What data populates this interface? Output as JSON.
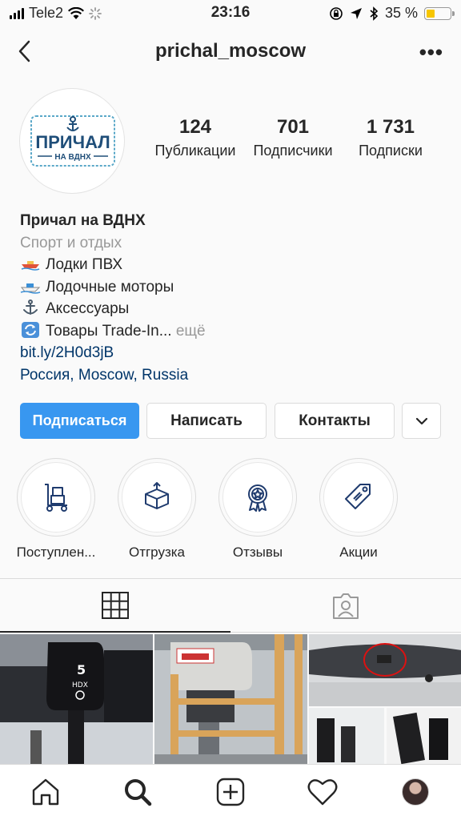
{
  "status": {
    "carrier": "Tele2",
    "time": "23:16",
    "battery": "35 %",
    "battery_level": 0.35
  },
  "header": {
    "username": "prichal_moscow",
    "more": "•••"
  },
  "profile": {
    "avatar_logo_text": "ПРИЧАЛ",
    "avatar_logo_sub": "НА ВДНХ",
    "stats": [
      {
        "num": "124",
        "label": "Публикации"
      },
      {
        "num": "701",
        "label": "Подписчики"
      },
      {
        "num": "1 731",
        "label": "Подписки"
      }
    ]
  },
  "bio": {
    "name": "Причал на ВДНХ",
    "category": "Спорт и отдых",
    "lines": [
      {
        "emoji": "boat-emoji",
        "text": "Лодки ПВХ"
      },
      {
        "emoji": "motorboat-emoji",
        "text": "Лодочные моторы"
      },
      {
        "emoji": "anchor-emoji",
        "text": "Аксессуары"
      },
      {
        "emoji": "repeat-emoji",
        "text": "Товары Trade-In..."
      }
    ],
    "more": "ещё",
    "link": "bit.ly/2H0d3jB",
    "location": "Россия, Moscow, Russia"
  },
  "buttons": {
    "follow": "Подписаться",
    "message": "Написать",
    "contacts": "Контакты"
  },
  "highlights": [
    {
      "label": "Поступлен...",
      "icon": "hand-truck-icon"
    },
    {
      "label": "Отгрузка",
      "icon": "open-box-icon"
    },
    {
      "label": "Отзывы",
      "icon": "award-badge-icon"
    },
    {
      "label": "Акции",
      "icon": "price-tag-icon"
    }
  ],
  "colors": {
    "accent": "#3897f0",
    "link": "#003569",
    "muted": "#999999"
  }
}
